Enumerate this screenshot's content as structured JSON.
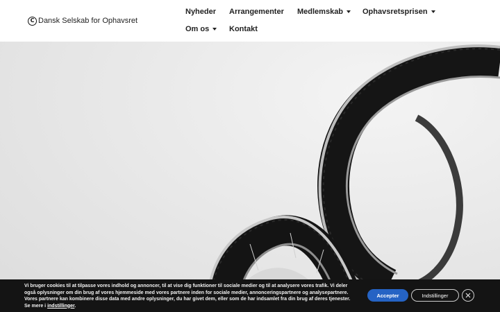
{
  "header": {
    "logo_mark": "C",
    "logo_text": "Dansk Selskab for Ophavsret"
  },
  "nav": {
    "items": [
      {
        "label": "Nyheder",
        "dropdown": false
      },
      {
        "label": "Arrangementer",
        "dropdown": false
      },
      {
        "label": "Medlemskab",
        "dropdown": true
      },
      {
        "label": "Ophavsretsprisen",
        "dropdown": true
      },
      {
        "label": "Om os",
        "dropdown": true
      },
      {
        "label": "Kontakt",
        "dropdown": false
      }
    ]
  },
  "cookie": {
    "text": "Vi bruger cookies til at tilpasse vores indhold og annoncer, til at vise dig funktioner til sociale medier og til at analysere vores trafik. Vi deler også oplysninger om din brug af vores hjemmeside med vores partnere inden for sociale medier, annonceringspartnere og analysepartnere. Vores partnere kan kombinere disse data med andre oplysninger, du har givet dem, eller som de har indsamlet fra din brug af deres tjenester. Se mere i ",
    "link": "indstillinger",
    "end": ".",
    "accept_label": "Accepter",
    "settings_label": "Indstillinger",
    "close_icon": "close-icon"
  },
  "colors": {
    "accent": "#2563c4",
    "banner_bg": "#141414"
  }
}
